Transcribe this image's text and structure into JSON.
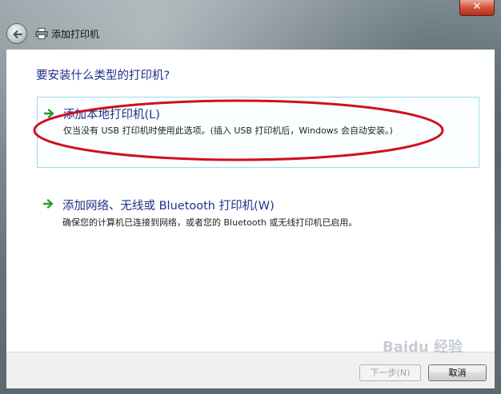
{
  "window": {
    "title": "添加打印机",
    "close_label": "✕"
  },
  "content": {
    "question": "要安装什么类型的打印机?",
    "options": [
      {
        "title": "添加本地打印机(L)",
        "description": "仅当没有 USB 打印机时使用此选项。(插入 USB 打印机后，Windows 会自动安装。)"
      },
      {
        "title": "添加网络、无线或 Bluetooth 打印机(W)",
        "description": "确保您的计算机已连接到网络，或者您的 Bluetooth 或无线打印机已启用。"
      }
    ]
  },
  "footer": {
    "next_label": "下一步(N)",
    "cancel_label": "取消"
  },
  "watermark": {
    "text": "Baidu 经验"
  },
  "colors": {
    "link_blue": "#1e3287",
    "option_border": "#9fdbe6",
    "annotation_red": "#d0101c",
    "arrow_green": "#2a9a2a"
  }
}
